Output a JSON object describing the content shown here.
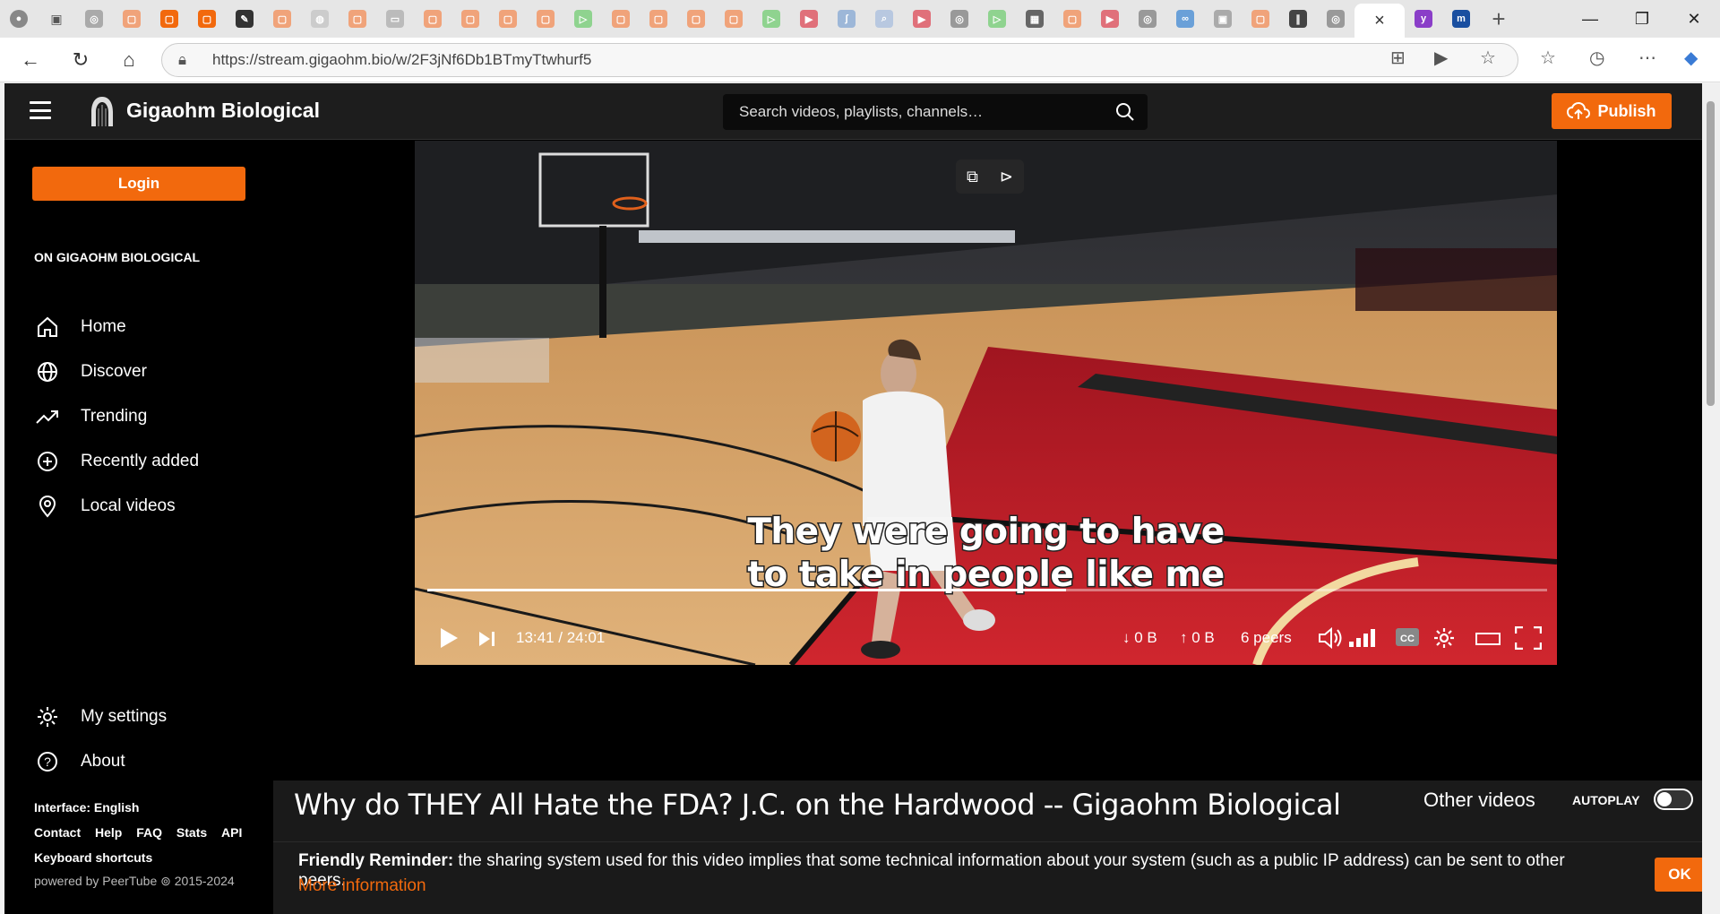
{
  "browser": {
    "url": "https://stream.gigaohm.bio/w/2F3jNf6Db1BTmyTtwhurf5",
    "active_tab_close": "×",
    "new_tab": "+"
  },
  "header": {
    "brand": "Gigaohm Biological",
    "search_placeholder": "Search videos, playlists, channels…",
    "publish_label": "Publish"
  },
  "sidebar": {
    "login_label": "Login",
    "section_title": "ON GIGAOHM BIOLOGICAL",
    "items": [
      {
        "label": "Home",
        "icon": "home-icon"
      },
      {
        "label": "Discover",
        "icon": "globe-icon"
      },
      {
        "label": "Trending",
        "icon": "trending-icon"
      },
      {
        "label": "Recently added",
        "icon": "plus-circle-icon"
      },
      {
        "label": "Local videos",
        "icon": "location-icon"
      }
    ],
    "bottom_items": [
      {
        "label": "My settings",
        "icon": "gear-icon"
      },
      {
        "label": "About",
        "icon": "help-icon"
      }
    ],
    "interface_label": "Interface:",
    "interface_value": "English",
    "footer_links": [
      "Contact",
      "Help",
      "FAQ",
      "Stats",
      "API"
    ],
    "keyboard_shortcuts": "Keyboard shortcuts",
    "powered_by": "powered by PeerTube ⊚ 2015-2024"
  },
  "player": {
    "subtitle_line1": "They were going to have",
    "subtitle_line2": "to take in people like me",
    "time": "13:41 / 24:01",
    "progress": 0.57,
    "download": "↓ 0 B",
    "upload": "↑ 0 B",
    "peers": "6 peers"
  },
  "video": {
    "title": "Why do THEY All Hate the FDA? J.C. on the Hardwood -- Gigaohm Biological",
    "other_videos": "Other videos",
    "autoplay": "AUTOPLAY"
  },
  "reminder": {
    "bold": "Friendly Reminder:",
    "text": " the sharing system used for this video implies that some technical information about your system (such as a public IP address) can be sent to other peers.",
    "more": "More information",
    "ok": "OK"
  },
  "colors": {
    "accent": "#f2690d",
    "header_bg": "#1d1d1d",
    "court_red": "#c8202a",
    "court_wood": "#d9a565"
  }
}
